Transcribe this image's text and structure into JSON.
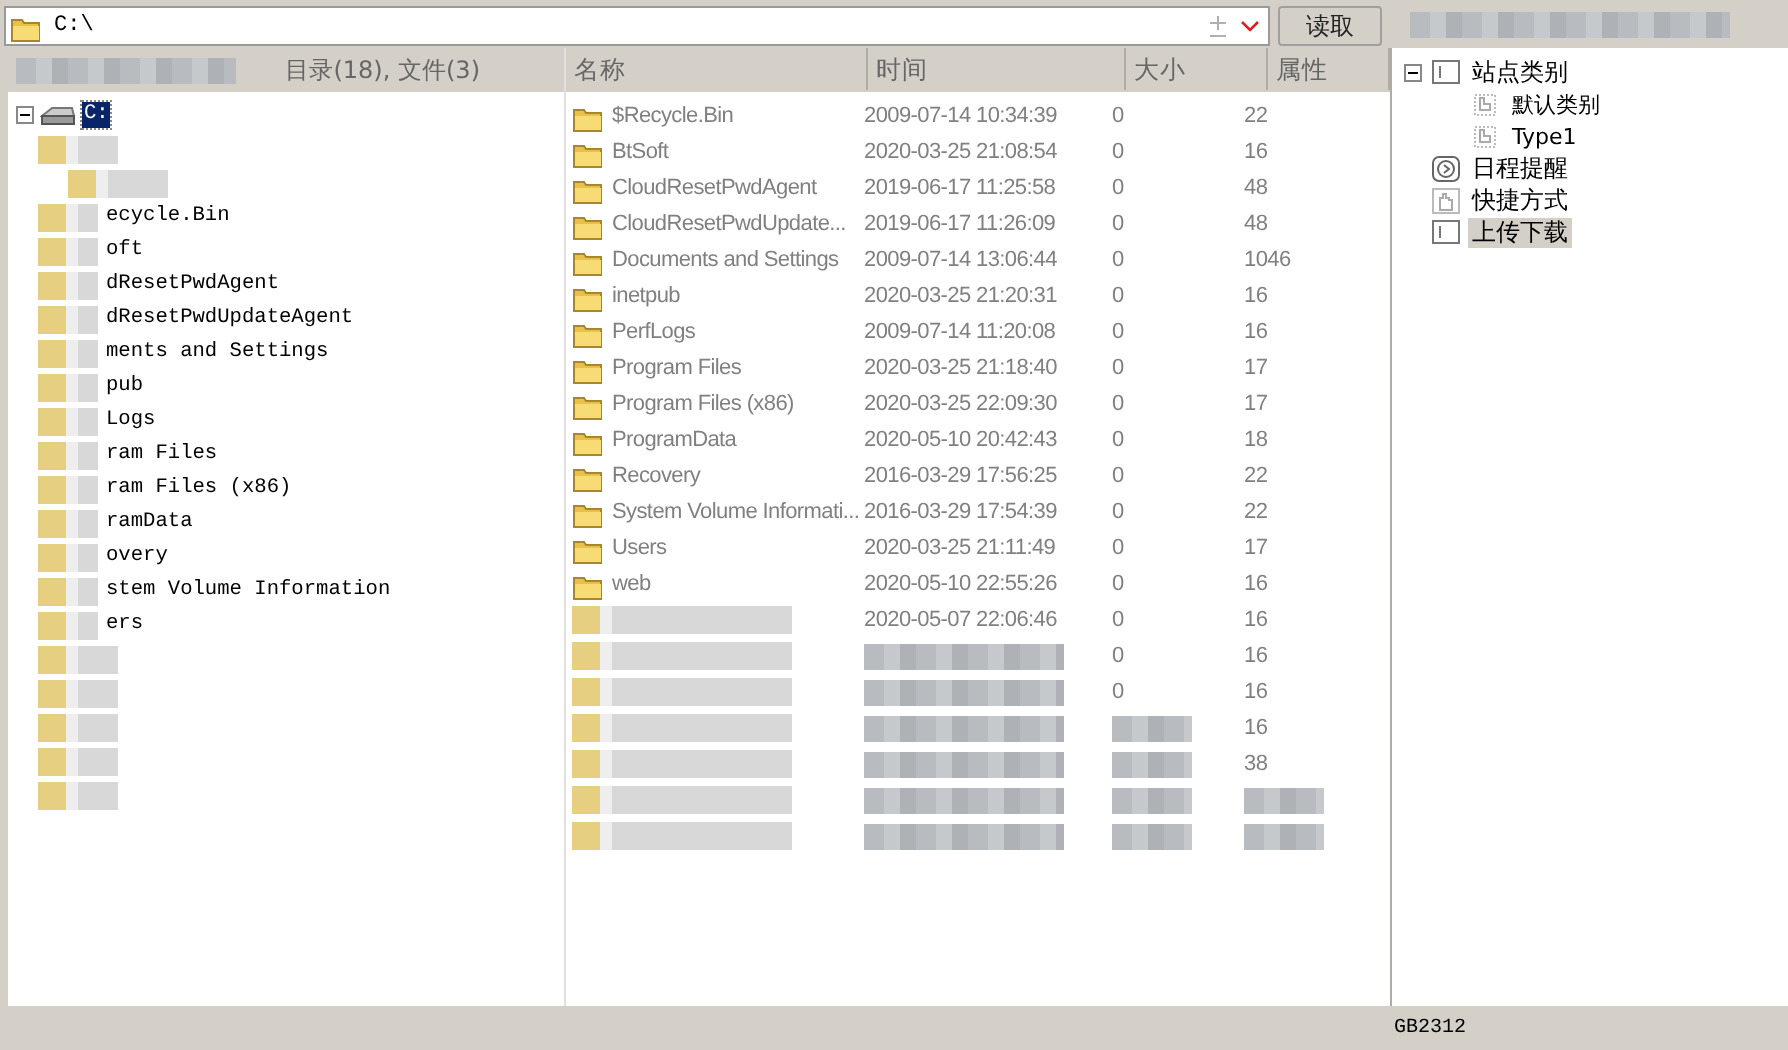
{
  "address_bar": {
    "value": "C:\\",
    "button": "读取"
  },
  "folder_tree": {
    "summary": "目录(18), 文件(3)",
    "root": {
      "label": "C:",
      "selected": true,
      "expanded": true,
      "children": [
        {
          "kind": "blurred",
          "children": [
            {
              "kind": "blurred"
            }
          ]
        },
        {
          "kind": "folder",
          "label": "ecycle.Bin"
        },
        {
          "kind": "folder",
          "label": "oft"
        },
        {
          "kind": "folder",
          "label": "dResetPwdAgent"
        },
        {
          "kind": "folder",
          "label": "dResetPwdUpdateAgent"
        },
        {
          "kind": "folder",
          "label": "ments and Settings"
        },
        {
          "kind": "folder",
          "label": "pub"
        },
        {
          "kind": "folder",
          "label": "Logs"
        },
        {
          "kind": "folder",
          "label": "ram Files"
        },
        {
          "kind": "folder",
          "label": "ram Files (x86)"
        },
        {
          "kind": "folder",
          "label": "ramData"
        },
        {
          "kind": "folder",
          "label": "overy"
        },
        {
          "kind": "folder",
          "label": "stem Volume Information"
        },
        {
          "kind": "folder",
          "label": "ers"
        },
        {
          "kind": "blurred"
        },
        {
          "kind": "blurred"
        },
        {
          "kind": "blurred"
        },
        {
          "kind": "blurred"
        },
        {
          "kind": "blurred"
        }
      ]
    }
  },
  "file_table": {
    "columns": [
      "名称",
      "时间",
      "大小",
      "属性"
    ],
    "rows": [
      {
        "kind": "folder",
        "cells": [
          "$Recycle.Bin",
          "2009-07-14 10:34:39",
          "0",
          "22"
        ]
      },
      {
        "kind": "folder",
        "cells": [
          "BtSoft",
          "2020-03-25 21:08:54",
          "0",
          "16"
        ]
      },
      {
        "kind": "folder",
        "cells": [
          "CloudResetPwdAgent",
          "2019-06-17 11:25:58",
          "0",
          "48"
        ]
      },
      {
        "kind": "folder",
        "cells": [
          "CloudResetPwdUpdate...",
          "2019-06-17 11:26:09",
          "0",
          "48"
        ]
      },
      {
        "kind": "folder",
        "cells": [
          "Documents and Settings",
          "2009-07-14 13:06:44",
          "0",
          "1046"
        ]
      },
      {
        "kind": "folder",
        "cells": [
          "inetpub",
          "2020-03-25 21:20:31",
          "0",
          "16"
        ]
      },
      {
        "kind": "folder",
        "cells": [
          "PerfLogs",
          "2009-07-14 11:20:08",
          "0",
          "16"
        ]
      },
      {
        "kind": "folder",
        "cells": [
          "Program Files",
          "2020-03-25 21:18:40",
          "0",
          "17"
        ]
      },
      {
        "kind": "folder",
        "cells": [
          "Program Files (x86)",
          "2020-03-25 22:09:30",
          "0",
          "17"
        ]
      },
      {
        "kind": "folder",
        "cells": [
          "ProgramData",
          "2020-05-10 20:42:43",
          "0",
          "18"
        ]
      },
      {
        "kind": "folder",
        "cells": [
          "Recovery",
          "2016-03-29 17:56:25",
          "0",
          "22"
        ]
      },
      {
        "kind": "folder",
        "cells": [
          "System Volume Informati...",
          "2016-03-29 17:54:39",
          "0",
          "22"
        ]
      },
      {
        "kind": "folder",
        "cells": [
          "Users",
          "2020-03-25 21:11:49",
          "0",
          "17"
        ]
      },
      {
        "kind": "folder",
        "cells": [
          "web",
          "2020-05-10 22:55:26",
          "0",
          "16"
        ]
      },
      {
        "kind": "blurred",
        "cells": [
          "",
          "2020-05-07 22:06:46",
          "0",
          "16"
        ]
      },
      {
        "kind": "blurred",
        "cells": [
          "",
          "",
          "0",
          "16"
        ]
      },
      {
        "kind": "blurred",
        "cells": [
          "",
          "",
          "0",
          "16"
        ]
      },
      {
        "kind": "blurred",
        "cells": [
          "",
          "",
          "",
          "16"
        ]
      },
      {
        "kind": "blurred",
        "cells": [
          "",
          "",
          "",
          "38"
        ]
      },
      {
        "kind": "blurred",
        "cells": [
          "",
          "",
          "",
          ""
        ]
      },
      {
        "kind": "blurred",
        "cells": [
          "",
          "",
          "",
          ""
        ]
      }
    ]
  },
  "site_tree": [
    {
      "kind": "category",
      "label": "站点类别",
      "expanded": true,
      "selected": false,
      "children": [
        {
          "kind": "page",
          "label": "默认类别",
          "selected": false
        },
        {
          "kind": "page",
          "label": "Type1",
          "selected": false
        }
      ]
    },
    {
      "kind": "schedule",
      "label": "日程提醒",
      "selected": false
    },
    {
      "kind": "shortcut",
      "label": "快捷方式",
      "selected": false
    },
    {
      "kind": "category",
      "label": "上传下载",
      "selected": true
    }
  ],
  "status_bar": {
    "encoding": "GB2312"
  }
}
